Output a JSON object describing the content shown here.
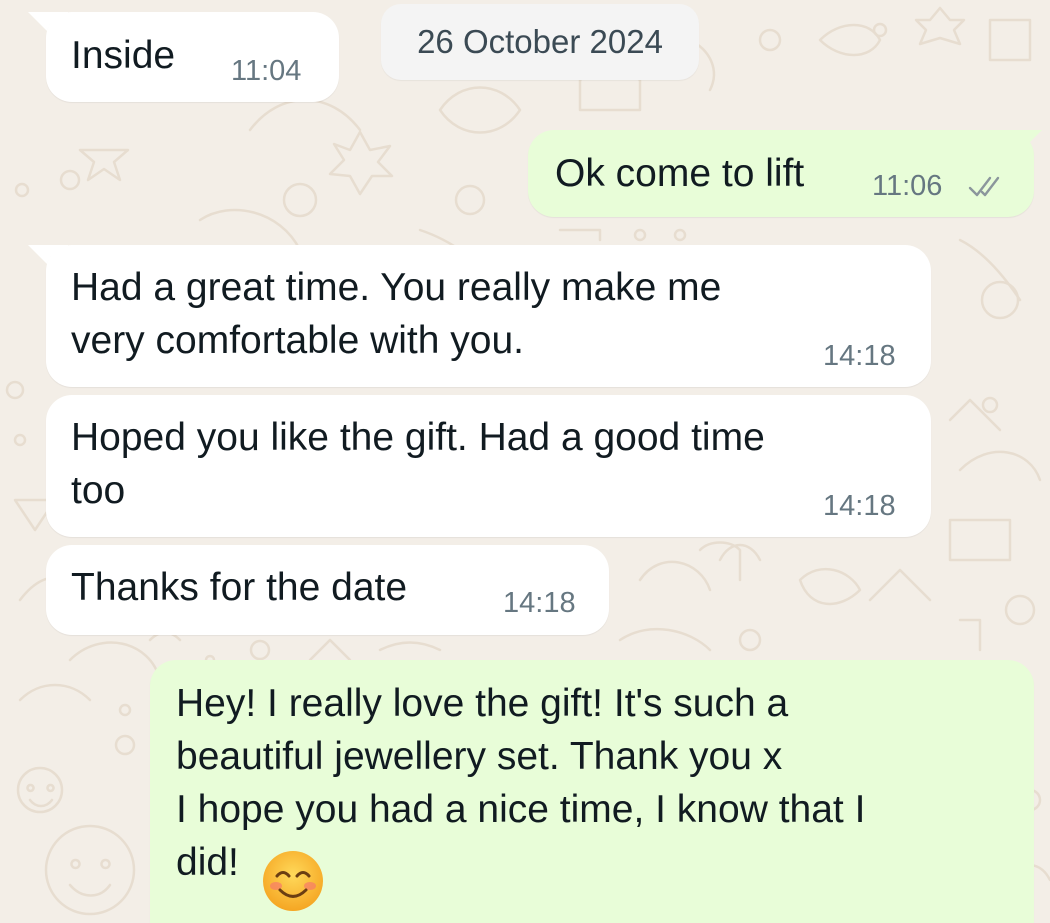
{
  "theme": {
    "wallpaper_color": "#f3eee7",
    "incoming_bubble_color": "#ffffff",
    "outgoing_bubble_color": "#e8fdd8",
    "timestamp_color": "#667781"
  },
  "date_separator": "26 October 2024",
  "messages": [
    {
      "direction": "incoming",
      "text": "Inside",
      "time": "11:04"
    },
    {
      "direction": "outgoing",
      "text": "Ok come to lift",
      "time": "11:06",
      "status_icon": "double-tick-icon"
    },
    {
      "direction": "incoming",
      "text": "Had a great time. You really make me\nvery comfortable with you.",
      "time": "14:18"
    },
    {
      "direction": "incoming",
      "text": "Hoped you like the gift. Had a good time\ntoo",
      "time": "14:18"
    },
    {
      "direction": "incoming",
      "text": "Thanks for the date",
      "time": "14:18"
    },
    {
      "direction": "outgoing",
      "text": "Hey! I really love the gift! It's such a\nbeautiful jewellery set. Thank you x\nI hope you had a nice time, I know that I\ndid!",
      "emoji": "smiling-face-icon"
    }
  ]
}
